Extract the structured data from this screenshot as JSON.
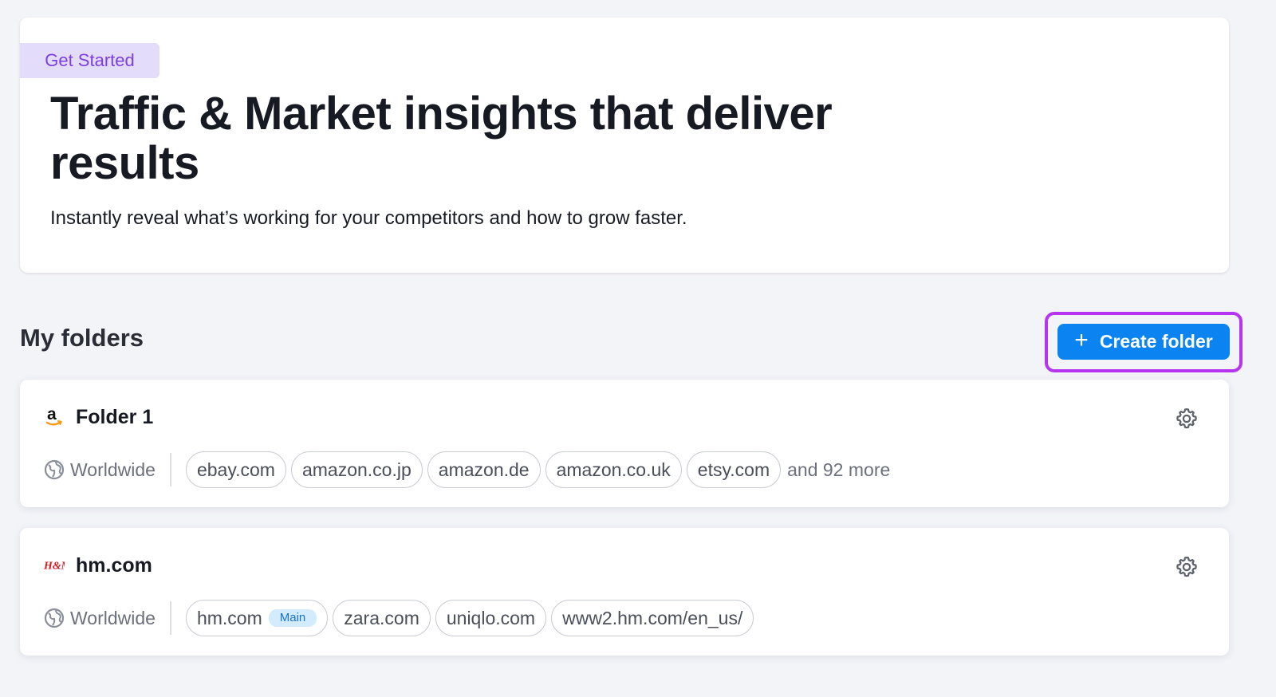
{
  "hero": {
    "badge": "Get Started",
    "title": "Traffic & Market insights that deliver results",
    "subtitle": "Instantly reveal what’s working for your competitors and how to grow faster."
  },
  "folders_section": {
    "title": "My folders",
    "create_button": {
      "label": "Create folder",
      "icon": "plus-icon",
      "color": "#0b83f1"
    },
    "highlight_color": "#b535f0"
  },
  "folders": [
    {
      "name": "Folder 1",
      "logo": "amazon-logo",
      "region": "Worldwide",
      "domains": [
        "ebay.com",
        "amazon.co.jp",
        "amazon.de",
        "amazon.co.uk",
        "etsy.com"
      ],
      "more": "and 92 more"
    },
    {
      "name": "hm.com",
      "logo": "hm-logo",
      "logo_text": "H&M",
      "region": "Worldwide",
      "domains": [
        "hm.com",
        "zara.com",
        "uniqlo.com",
        "www2.hm.com/en_us/"
      ],
      "main_tag": "Main"
    }
  ]
}
